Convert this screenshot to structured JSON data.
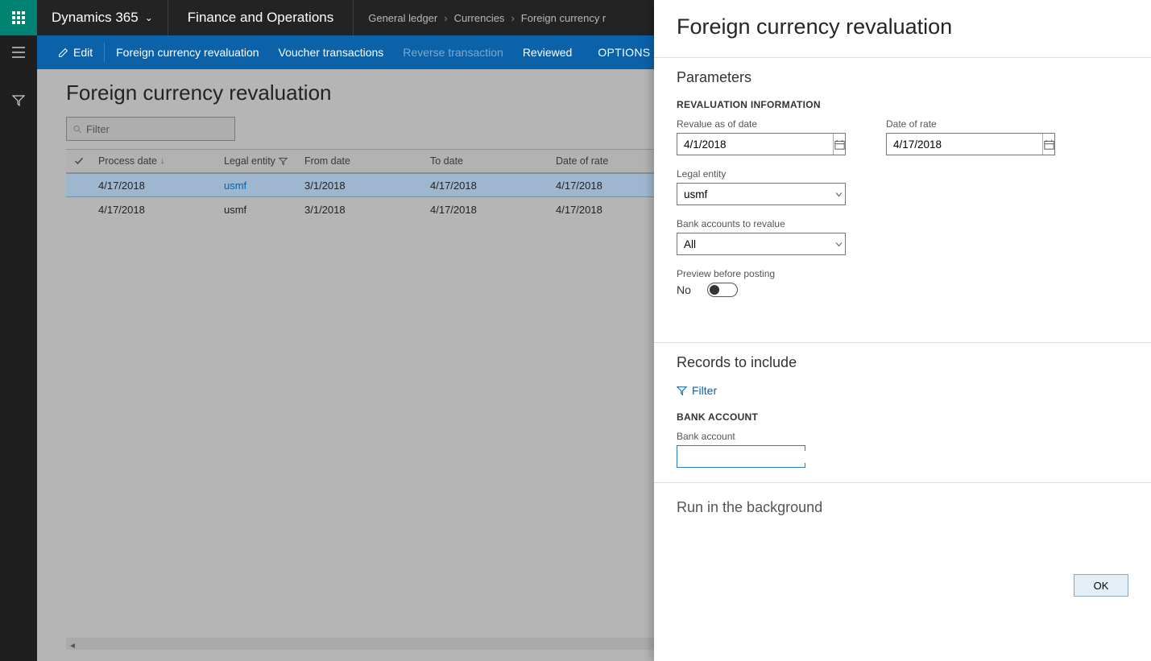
{
  "topbar": {
    "brand": "Dynamics 365",
    "module": "Finance and Operations",
    "breadcrumb": [
      "General ledger",
      "Currencies",
      "Foreign currency r"
    ]
  },
  "actionbar": {
    "edit": "Edit",
    "fcr": "Foreign currency revaluation",
    "voucher": "Voucher transactions",
    "reverse": "Reverse transaction",
    "reviewed": "Reviewed",
    "options": "OPTIONS"
  },
  "page": {
    "title": "Foreign currency revaluation",
    "filter_placeholder": "Filter"
  },
  "grid": {
    "columns": {
      "process_date": "Process date",
      "legal_entity": "Legal entity",
      "from_date": "From date",
      "to_date": "To date",
      "date_of_rate": "Date of rate"
    },
    "rows": [
      {
        "process_date": "4/17/2018",
        "legal_entity": "usmf",
        "from_date": "3/1/2018",
        "to_date": "4/17/2018",
        "date_of_rate": "4/17/2018",
        "selected": true
      },
      {
        "process_date": "4/17/2018",
        "legal_entity": "usmf",
        "from_date": "3/1/2018",
        "to_date": "4/17/2018",
        "date_of_rate": "4/17/2018",
        "selected": false
      }
    ]
  },
  "panel": {
    "title": "Foreign currency revaluation",
    "parameters_title": "Parameters",
    "revaluation_info": "REVALUATION INFORMATION",
    "fields": {
      "revalue_as_of_date": {
        "label": "Revalue as of date",
        "value": "4/1/2018"
      },
      "date_of_rate": {
        "label": "Date of rate",
        "value": "4/17/2018"
      },
      "legal_entity": {
        "label": "Legal entity",
        "value": "usmf"
      },
      "bank_accounts": {
        "label": "Bank accounts to revalue",
        "value": "All"
      },
      "preview": {
        "label": "Preview before posting",
        "value": "No"
      }
    },
    "records_title": "Records to include",
    "filter_link": "Filter",
    "bank_account_heading": "BANK ACCOUNT",
    "bank_account_label": "Bank account",
    "bank_account_value": "",
    "run_background": "Run in the background",
    "ok": "OK"
  }
}
